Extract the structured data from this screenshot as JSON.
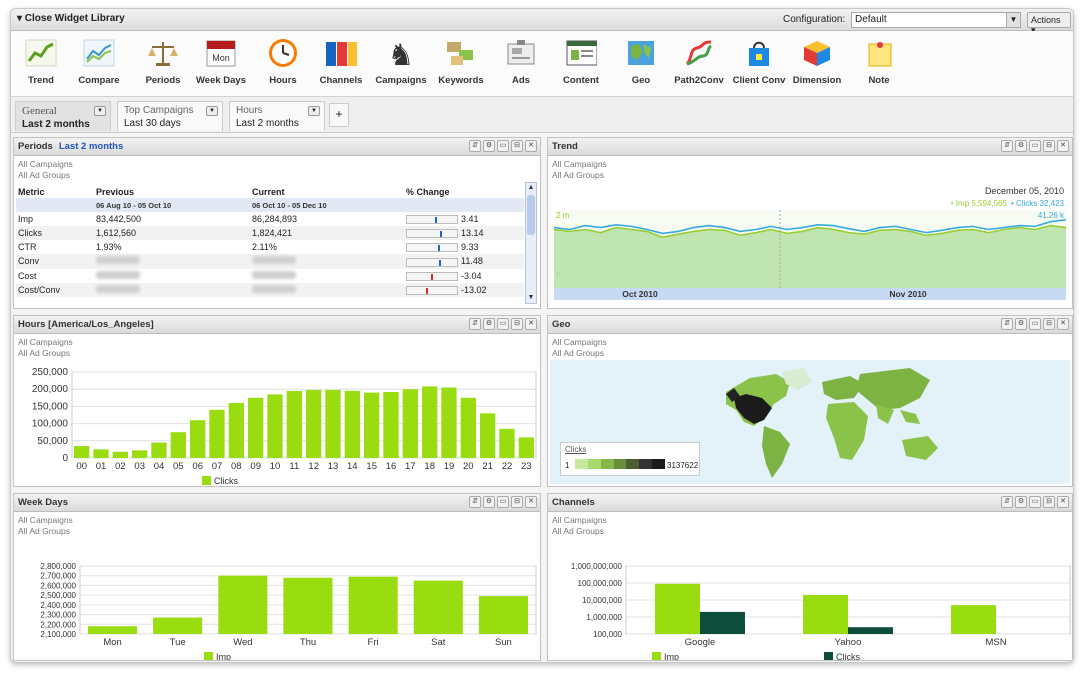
{
  "topbar": {
    "collapse_label": "▾ Close Widget Library",
    "config_label": "Configuration:",
    "config_value": "Default",
    "actions_label": "Actions ▾"
  },
  "library": [
    {
      "label": "Trend",
      "icon": "trend-chart-icon"
    },
    {
      "label": "Compare",
      "icon": "compare-chart-icon"
    },
    {
      "label": "Periods",
      "icon": "scale-icon"
    },
    {
      "label": "Week Days",
      "icon": "calendar-icon",
      "badge": "Mon"
    },
    {
      "label": "Hours",
      "icon": "clock-icon"
    },
    {
      "label": "Channels",
      "icon": "channels-icon"
    },
    {
      "label": "Campaigns",
      "icon": "chess-knight-icon"
    },
    {
      "label": "Keywords",
      "icon": "keywords-icon"
    },
    {
      "label": "Ads",
      "icon": "ads-icon"
    },
    {
      "label": "Content",
      "icon": "content-window-icon"
    },
    {
      "label": "Geo",
      "icon": "map-icon"
    },
    {
      "label": "Path2Conv",
      "icon": "path-icon"
    },
    {
      "label": "Client Conv",
      "icon": "bag-icon"
    },
    {
      "label": "Dimension",
      "icon": "cube-icon"
    },
    {
      "label": "Note",
      "icon": "note-icon"
    }
  ],
  "tabs": [
    {
      "title": "General",
      "period": "Last 2 months",
      "active": true
    },
    {
      "title": "Top Campaigns",
      "period": "Last 30 days",
      "active": false
    },
    {
      "title": "Hours",
      "period": "Last 2 months",
      "active": false
    }
  ],
  "add_tab": "+",
  "scope": {
    "campaigns": "All Campaigns",
    "ad_groups": "All Ad Groups"
  },
  "panel_ctrls": [
    "⇵",
    "⚙",
    "▭",
    "⊟",
    "✕"
  ],
  "periods": {
    "title": "Periods",
    "subtitle": "Last 2 months",
    "headers": {
      "metric": "Metric",
      "previous": "Previous",
      "current": "Current",
      "change": "% Change"
    },
    "prev_range": "06 Aug 10 - 05 Oct 10",
    "curr_range": "06 Oct 10 - 05 Dec 10",
    "rows": [
      {
        "metric": "Imp",
        "previous": "83,442,500",
        "current": "86,284,893",
        "change": "3.41",
        "pct": 3.41
      },
      {
        "metric": "Clicks",
        "previous": "1,612,560",
        "current": "1,824,421",
        "change": "13.14",
        "pct": 13.14
      },
      {
        "metric": "CTR",
        "previous": "1.93%",
        "current": "2.11%",
        "change": "9.33",
        "pct": 9.33
      },
      {
        "metric": "Conv",
        "previous": "",
        "current": "",
        "change": "11.48",
        "pct": 11.48
      },
      {
        "metric": "Cost",
        "previous": "",
        "current": "",
        "change": "-3.04",
        "pct": -3.04
      },
      {
        "metric": "Cost/Conv",
        "previous": "",
        "current": "",
        "change": "-13.02",
        "pct": -13.02
      }
    ]
  },
  "trend": {
    "title": "Trend",
    "date": "December 05, 2010",
    "legend_imp": "• Imp 5,594,565",
    "legend_clicks": "• Clicks 32,423",
    "y_left": "2 m",
    "y_right": "41.26 k",
    "y_zero": "0",
    "x_labels": [
      "Oct 2010",
      "Nov 2010"
    ],
    "colors": {
      "imp": "#9acd32",
      "clicks": "#33aadd"
    }
  },
  "hours": {
    "title": "Hours [America/Los_Angeles]",
    "legend": "Clicks"
  },
  "geo": {
    "title": "Geo",
    "legend_label": "Clicks",
    "legend_min": "1",
    "legend_max": "3137622"
  },
  "weekdays": {
    "title": "Week Days",
    "legend": "Imp"
  },
  "channels": {
    "title": "Channels",
    "legend_imp": "Imp",
    "legend_clicks": "Clicks"
  },
  "chart_data": [
    {
      "type": "line",
      "title": "Trend",
      "x_labels": [
        "Oct 2010",
        "Nov 2010"
      ],
      "series": [
        {
          "name": "Imp",
          "values": [
            1.5,
            1.45,
            1.5,
            1.42,
            1.55,
            1.5,
            1.45,
            1.3,
            1.38,
            1.45,
            1.5,
            1.48,
            1.35,
            1.42,
            1.5,
            1.4,
            1.45,
            1.55,
            1.5,
            1.42,
            1.38,
            1.48,
            1.5,
            1.45,
            1.35,
            1.4,
            1.48,
            1.5,
            1.42,
            1.5,
            1.55,
            1.5,
            1.6,
            1.55
          ]
        },
        {
          "name": "Clicks",
          "values": [
            1.55,
            1.5,
            1.6,
            1.55,
            1.62,
            1.58,
            1.5,
            1.4,
            1.45,
            1.55,
            1.6,
            1.55,
            1.45,
            1.5,
            1.58,
            1.5,
            1.55,
            1.62,
            1.6,
            1.52,
            1.45,
            1.55,
            1.58,
            1.5,
            1.42,
            1.48,
            1.55,
            1.58,
            1.5,
            1.55,
            1.6,
            1.58,
            1.7,
            1.75
          ]
        }
      ]
    },
    {
      "type": "bar",
      "title": "Hours [America/Los_Angeles]",
      "categories": [
        "00",
        "01",
        "02",
        "03",
        "04",
        "05",
        "06",
        "07",
        "08",
        "09",
        "10",
        "11",
        "12",
        "13",
        "14",
        "15",
        "16",
        "17",
        "18",
        "19",
        "20",
        "21",
        "22",
        "23"
      ],
      "series": [
        {
          "name": "Clicks",
          "values": [
            35000,
            25000,
            18000,
            22000,
            45000,
            75000,
            110000,
            140000,
            160000,
            175000,
            185000,
            195000,
            198000,
            198000,
            195000,
            190000,
            192000,
            200000,
            208000,
            205000,
            175000,
            130000,
            85000,
            60000
          ]
        }
      ],
      "yticks": [
        0,
        50000,
        100000,
        150000,
        200000,
        250000
      ],
      "ytick_labels": [
        "0",
        "50,000",
        "100,000",
        "150,000",
        "200,000",
        "250,000"
      ],
      "ylim": [
        0,
        250000
      ]
    },
    {
      "type": "bar",
      "title": "Week Days",
      "categories": [
        "Mon",
        "Tue",
        "Wed",
        "Thu",
        "Fri",
        "Sat",
        "Sun"
      ],
      "series": [
        {
          "name": "Imp",
          "values": [
            2180000,
            2270000,
            2700000,
            2680000,
            2690000,
            2650000,
            2490000
          ]
        }
      ],
      "yticks": [
        2100000,
        2200000,
        2300000,
        2400000,
        2500000,
        2600000,
        2700000,
        2800000
      ],
      "ytick_labels": [
        "2,100,000",
        "2,200,000",
        "2,300,000",
        "2,400,000",
        "2,500,000",
        "2,600,000",
        "2,700,000",
        "2,800,000"
      ],
      "ylim": [
        2100000,
        2800000
      ]
    },
    {
      "type": "bar",
      "title": "Channels",
      "categories": [
        "Google",
        "Yahoo",
        "MSN"
      ],
      "series": [
        {
          "name": "Imp",
          "values": [
            90000000,
            20000000,
            5000000
          ]
        },
        {
          "name": "Clicks",
          "values": [
            2000000,
            250000,
            100000
          ]
        }
      ],
      "yscale": "log",
      "yticks": [
        100000,
        1000000,
        10000000,
        100000000,
        1000000000
      ],
      "ytick_labels": [
        "100,000",
        "1,000,000",
        "10,000,000",
        "100,000,000",
        "1,000,000,000"
      ],
      "ylim": [
        100000,
        1000000000
      ]
    }
  ]
}
